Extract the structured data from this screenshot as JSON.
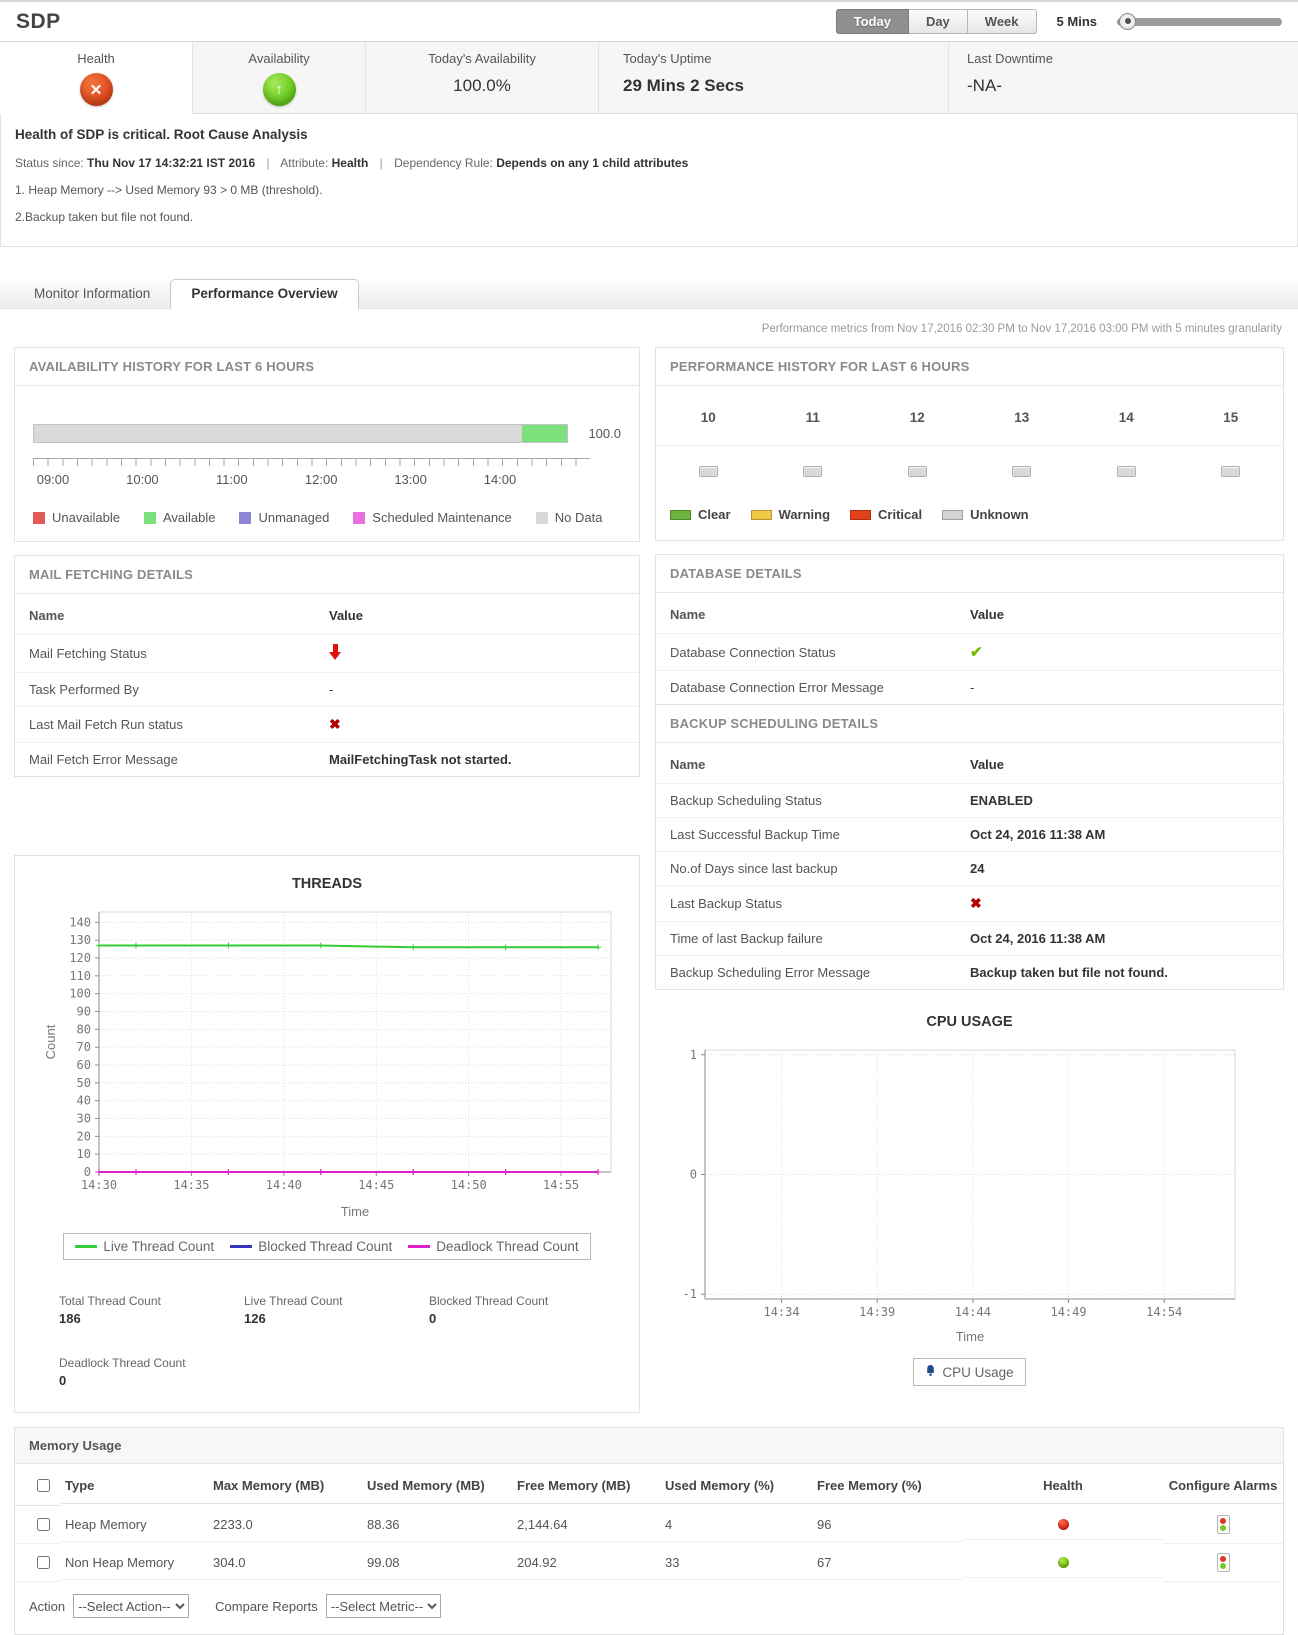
{
  "header": {
    "title": "SDP",
    "range_buttons": [
      {
        "label": "Today",
        "active": true
      },
      {
        "label": "Day",
        "active": false
      },
      {
        "label": "Week",
        "active": false
      }
    ],
    "interval_label": "5 Mins"
  },
  "summary": {
    "cells": [
      {
        "label": "Health",
        "status": "critical"
      },
      {
        "label": "Availability",
        "status": "up"
      },
      {
        "label": "Today's Availability",
        "value": "100.0%"
      },
      {
        "label": "Today's Uptime",
        "value": "29 Mins 2 Secs"
      },
      {
        "label": "Last Downtime",
        "value": "-NA-"
      }
    ]
  },
  "alert": {
    "title": "Health of SDP is critical. Root Cause Analysis",
    "status_since_label": "Status since:",
    "status_since": "Thu Nov 17 14:32:21 IST 2016",
    "attribute_label": "Attribute:",
    "attribute": "Health",
    "dependency_label": "Dependency Rule:",
    "dependency": "Depends on any 1 child attributes",
    "causes": [
      "1. Heap Memory --> Used Memory 93 > 0 MB (threshold).",
      "2.Backup taken but file not found."
    ]
  },
  "tabs": [
    {
      "label": "Monitor Information",
      "active": false
    },
    {
      "label": "Performance Overview",
      "active": true
    }
  ],
  "metrics_note": "Performance metrics from Nov 17,2016 02:30 PM to Nov 17,2016 03:00 PM with 5 minutes granularity",
  "availability_history": {
    "title": "AVAILABILITY HISTORY FOR LAST 6 HOURS",
    "value_label": "100.0",
    "bar_segments": [
      {
        "name": "No Data",
        "pct": 91.5,
        "color": "#d9d9d9"
      },
      {
        "name": "Available",
        "pct": 8.5,
        "color": "#7de07d"
      }
    ],
    "axis_labels": [
      "09:00",
      "10:00",
      "11:00",
      "12:00",
      "13:00",
      "14:00"
    ],
    "legend": [
      {
        "label": "Unavailable",
        "color": "#e25b5b"
      },
      {
        "label": "Available",
        "color": "#7de07d"
      },
      {
        "label": "Unmanaged",
        "color": "#8d85d8"
      },
      {
        "label": "Scheduled Maintenance",
        "color": "#ea6fe0"
      },
      {
        "label": "No Data",
        "color": "#d8d8d8"
      }
    ]
  },
  "performance_history": {
    "title": "PERFORMANCE HISTORY FOR LAST 6 HOURS",
    "hours": [
      "10",
      "11",
      "12",
      "13",
      "14",
      "15"
    ],
    "cell_state": "unknown",
    "legend": [
      {
        "label": "Clear",
        "color": "#6db33f"
      },
      {
        "label": "Warning",
        "color": "#f0c846"
      },
      {
        "label": "Critical",
        "color": "#e2401b"
      },
      {
        "label": "Unknown",
        "color": "#d4d4d4"
      }
    ]
  },
  "mail_fetching": {
    "title": "MAIL FETCHING DETAILS",
    "name_header": "Name",
    "value_header": "Value",
    "rows": [
      {
        "name": "Mail Fetching Status",
        "icon": "down"
      },
      {
        "name": "Task Performed By",
        "text": "-",
        "bold": false
      },
      {
        "name": "Last Mail Fetch Run status",
        "icon": "cross"
      },
      {
        "name": "Mail Fetch Error Message",
        "text": "MailFetchingTask not started.",
        "bold": true
      }
    ]
  },
  "database_details": {
    "title": "DATABASE DETAILS",
    "name_header": "Name",
    "value_header": "Value",
    "rows": [
      {
        "name": "Database Connection Status",
        "icon": "check"
      },
      {
        "name": "Database Connection Error Message",
        "text": "-",
        "bold": false
      }
    ]
  },
  "backup_details": {
    "title": "BACKUP SCHEDULING DETAILS",
    "name_header": "Name",
    "value_header": "Value",
    "rows": [
      {
        "name": "Backup Scheduling Status",
        "text": "ENABLED",
        "bold": true
      },
      {
        "name": "Last Successful Backup Time",
        "text": "Oct 24, 2016 11:38 AM",
        "bold": true
      },
      {
        "name": "No.of Days since last backup",
        "text": "24",
        "bold": true
      },
      {
        "name": "Last Backup Status",
        "icon": "cross"
      },
      {
        "name": "Time of last Backup failure",
        "text": "Oct 24, 2016 11:38 AM",
        "bold": true
      },
      {
        "name": "Backup Scheduling Error Message",
        "text": "Backup taken but file not found.",
        "bold": true
      }
    ]
  },
  "chart_data": [
    {
      "type": "line",
      "title": "THREADS",
      "xlabel": "Time",
      "ylabel": "Count",
      "ylim": [
        0,
        145.8
      ],
      "yticks": [
        0,
        10,
        20,
        30,
        40,
        50,
        60,
        70,
        80,
        90,
        100,
        110,
        120,
        130,
        140
      ],
      "xlim": [
        0,
        27.7
      ],
      "x_minutes": [
        0,
        2,
        7,
        12,
        17,
        22,
        27
      ],
      "xticks": [
        {
          "m": 0,
          "label": "14:30"
        },
        {
          "m": 5,
          "label": "14:35"
        },
        {
          "m": 10,
          "label": "14:40"
        },
        {
          "m": 15,
          "label": "14:45"
        },
        {
          "m": 20,
          "label": "14:50"
        },
        {
          "m": 25,
          "label": "14:55"
        }
      ],
      "grid": true,
      "legend_position": "bottom",
      "series": [
        {
          "name": "Live Thread Count",
          "color": "#33cc33",
          "values": [
            127,
            127,
            127,
            127,
            126,
            126,
            126
          ]
        },
        {
          "name": "Blocked Thread Count",
          "color": "#3333bb",
          "values": [
            0,
            0,
            0,
            0,
            0,
            0,
            0
          ]
        },
        {
          "name": "Deadlock Thread Count",
          "color": "#dd22cc",
          "values": [
            0,
            0,
            0,
            0,
            0,
            0,
            0
          ]
        }
      ]
    },
    {
      "type": "line",
      "title": "CPU USAGE",
      "xlabel": "Time",
      "ylabel": "",
      "ylim": [
        -1.04,
        1.04
      ],
      "yticks": [
        1,
        0,
        -1
      ],
      "xlim": [
        0,
        27.7
      ],
      "x_minutes": [],
      "xticks": [
        {
          "m": 4,
          "label": "14:34"
        },
        {
          "m": 9,
          "label": "14:39"
        },
        {
          "m": 14,
          "label": "14:44"
        },
        {
          "m": 19,
          "label": "14:49"
        },
        {
          "m": 24,
          "label": "14:54"
        }
      ],
      "grid": true,
      "legend_position": "bottom",
      "series": [
        {
          "name": "CPU Usage",
          "color": "#1f4e8c",
          "values": []
        }
      ]
    }
  ],
  "thread_stats": [
    {
      "label": "Total Thread Count",
      "value": "186"
    },
    {
      "label": "Live Thread Count",
      "value": "126"
    },
    {
      "label": "Blocked Thread Count",
      "value": "0"
    },
    {
      "label": "Deadlock Thread Count",
      "value": "0"
    }
  ],
  "memory_usage": {
    "title": "Memory Usage",
    "columns": [
      "Type",
      "Max Memory  (MB)",
      "Used Memory  (MB)",
      "Free Memory  (MB)",
      "Used Memory  (%)",
      "Free Memory  (%)",
      "Health",
      "Configure Alarms"
    ],
    "rows": [
      {
        "type": "Heap Memory",
        "max": "2233.0",
        "used": "88.36",
        "free": "2,144.64",
        "used_pct": "4",
        "free_pct": "96",
        "health": "critical"
      },
      {
        "type": "Non Heap Memory",
        "max": "304.0",
        "used": "99.08",
        "free": "204.92",
        "used_pct": "33",
        "free_pct": "67",
        "health": "clear"
      }
    ],
    "action_label": "Action",
    "action_value": "--Select Action--",
    "compare_label": "Compare Reports",
    "compare_value": "--Select Metric--"
  }
}
